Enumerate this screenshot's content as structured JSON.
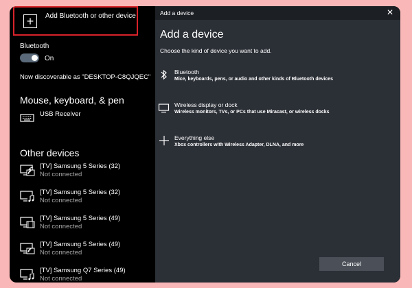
{
  "left_pane": {
    "add_button_label": "Add Bluetooth or other device",
    "bluetooth_label": "Bluetooth",
    "toggle_state": "On",
    "discoverable_text": "Now discoverable as \"DESKTOP-C8QJQEC\"",
    "section_mouse": "Mouse, keyboard, & pen",
    "usb_device": "USB Receiver",
    "section_other": "Other devices",
    "devices": [
      {
        "name": "[TV] Samsung 5 Series (32)",
        "status": "Not connected",
        "icon": "tv-cast-icon"
      },
      {
        "name": "[TV] Samsung 5 Series (32)",
        "status": "Not connected",
        "icon": "tv-music-icon"
      },
      {
        "name": "[TV] Samsung 5 Series (49)",
        "status": "Not connected",
        "icon": "tv-video-icon"
      },
      {
        "name": "[TV] Samsung 5 Series (49)",
        "status": "Not connected",
        "icon": "tv-cast-icon"
      },
      {
        "name": "[TV] Samsung Q7 Series (49)",
        "status": "Not connected",
        "icon": "tv-music-icon"
      }
    ]
  },
  "dialog": {
    "window_title": "Add a device",
    "close_glyph": "✕",
    "title": "Add a device",
    "subtitle": "Choose the kind of device you want to add.",
    "options": [
      {
        "name": "Bluetooth",
        "desc": "Mice, keyboards, pens, or audio and other kinds of Bluetooth devices",
        "icon": "bluetooth-icon"
      },
      {
        "name": "Wireless display or dock",
        "desc": "Wireless monitors, TVs, or PCs that use Miracast, or wireless docks",
        "icon": "monitor-icon"
      },
      {
        "name": "Everything else",
        "desc": "Xbox controllers with Wireless Adapter, DLNA, and more",
        "icon": "plus-icon"
      }
    ],
    "cancel_label": "Cancel"
  },
  "colors": {
    "page_bg": "#f9b7b7",
    "highlight": "#d8232a",
    "dialog_bg": "#2b2f36"
  }
}
